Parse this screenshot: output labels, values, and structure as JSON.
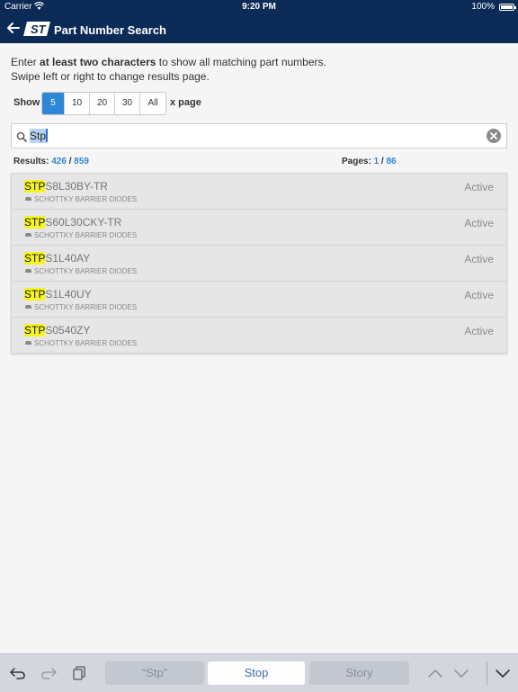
{
  "status_bar": {
    "carrier": "Carrier",
    "time": "9:20 PM",
    "battery": "100%"
  },
  "nav": {
    "title": "Part Number Search",
    "logo_text": "ST"
  },
  "intro": {
    "line1_pre": "Enter ",
    "line1_bold": "at least two characters",
    "line1_post": " to show all matching part numbers.",
    "line2": "Swipe left or right to change results page."
  },
  "show": {
    "label": "Show",
    "options": [
      "5",
      "10",
      "20",
      "30",
      "All"
    ],
    "selected": "5",
    "suffix": "x page"
  },
  "search": {
    "value": "Stp"
  },
  "results": {
    "label": "Results:",
    "count": "426",
    "sep": "/",
    "total": "859"
  },
  "pages": {
    "label": "Pages:",
    "current": "1",
    "sep": "/",
    "total": "86"
  },
  "list": [
    {
      "match": "STP",
      "rest": "S8L30BY-TR",
      "category": "SCHOTTKY BARRIER DIODES",
      "status": "Active"
    },
    {
      "match": "STP",
      "rest": "S60L30CKY-TR",
      "category": "SCHOTTKY BARRIER DIODES",
      "status": "Active"
    },
    {
      "match": "STP",
      "rest": "S1L40AY",
      "category": "SCHOTTKY BARRIER DIODES",
      "status": "Active"
    },
    {
      "match": "STP",
      "rest": "S1L40UY",
      "category": "SCHOTTKY BARRIER DIODES",
      "status": "Active"
    },
    {
      "match": "STP",
      "rest": "S0540ZY",
      "category": "SCHOTTKY BARRIER DIODES",
      "status": "Active"
    }
  ],
  "keyboard_bar": {
    "suggestions": [
      "“Stp”",
      "Stop",
      "Story"
    ]
  },
  "colors": {
    "header": "#0b2a55",
    "accent": "#2e86d6",
    "highlight": "#f5f522"
  }
}
